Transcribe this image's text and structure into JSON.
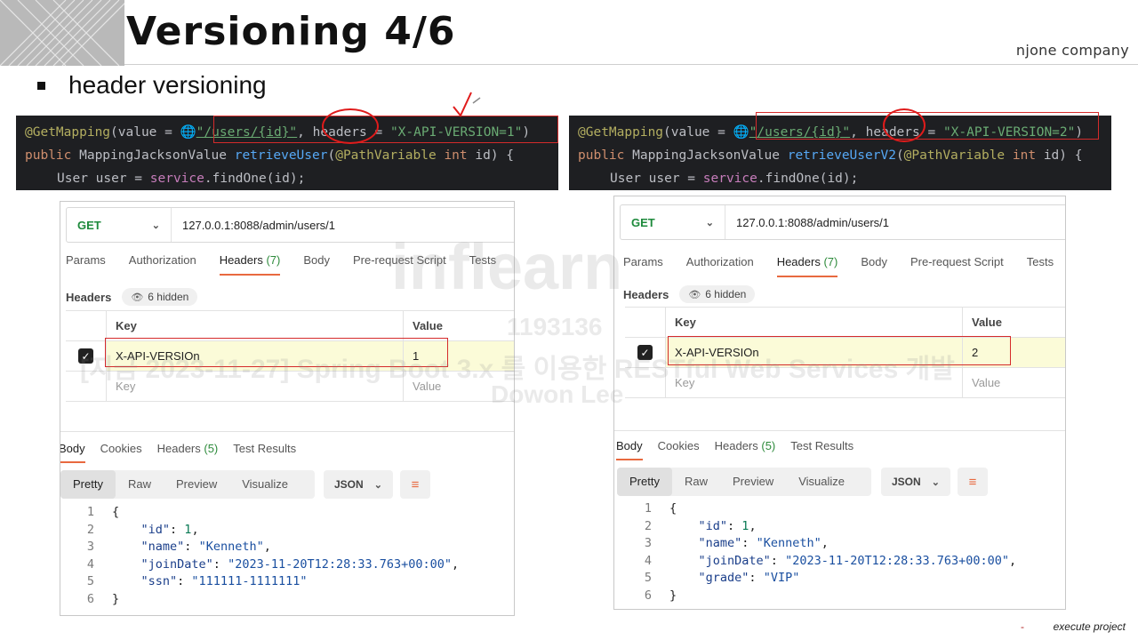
{
  "slide": {
    "title": "Versioning 4/6",
    "brand": "njone company",
    "bullet": "header versioning",
    "footer": "execute project",
    "footer_marker": "-"
  },
  "watermark": {
    "logo": "inflearn",
    "id": "1193136",
    "course": "[지금 2023-11-27] Spring Boot 3.x 를 이용한 RESTful Web Services 개발",
    "author": "Dowon Lee"
  },
  "code_left": {
    "l1_ann": "@GetMapping",
    "l1_a": "(value = ",
    "l1_globe": "🌐",
    "l1_url": "\"/users/{id}\"",
    "l1_b": ", ",
    "l1_headers": "headers",
    "l1_c": " = ",
    "l1_val": "\"X-API-VERSION=1\"",
    "l1_d": ")",
    "l2_kw": "public",
    "l2_type": " MappingJacksonValue ",
    "l2_fn": "retrieveUser",
    "l2_a": "(",
    "l2_ann": "@PathVariable",
    "l2_int": " int",
    "l2_b": " id) {",
    "l3_a": "User user = ",
    "l3_field": "service",
    "l3_b": ".findOne(id);"
  },
  "code_right": {
    "l1_ann": "@GetMapping",
    "l1_a": "(value = ",
    "l1_globe": "🌐",
    "l1_url": "\"/users/{id}\"",
    "l1_b": ", ",
    "l1_headers": "headers",
    "l1_c": " = ",
    "l1_val": "\"X-API-VERSION=2\"",
    "l1_d": ")",
    "l2_kw": "public",
    "l2_type": " MappingJacksonValue ",
    "l2_fn": "retrieveUserV2",
    "l2_a": "(",
    "l2_ann": "@PathVariable",
    "l2_int": " int",
    "l2_b": " id) {",
    "l3_a": "User user = ",
    "l3_field": "service",
    "l3_b": ".findOne(id);"
  },
  "postman_left": {
    "method": "GET",
    "url": "127.0.0.1:8088/admin/users/1",
    "tabs": {
      "params": "Params",
      "authorization": "Authorization",
      "headers": "Headers",
      "headers_count": "(7)",
      "body": "Body",
      "prerequest": "Pre-request Script",
      "tests": "Tests"
    },
    "headers_label": "Headers",
    "hidden": "6 hidden",
    "table": {
      "key_header": "Key",
      "value_header": "Value",
      "row_key": "X-API-VERSIOn",
      "row_value": "1",
      "key_placeholder": "Key",
      "value_placeholder": "Value"
    },
    "resp_tabs": {
      "body": "Body",
      "cookies": "Cookies",
      "headers": "Headers",
      "headers_count": "(5)",
      "tests": "Test Results"
    },
    "view": {
      "pretty": "Pretty",
      "raw": "Raw",
      "preview": "Preview",
      "visualize": "Visualize",
      "format": "JSON"
    },
    "json": {
      "n1": "1",
      "n2": "2",
      "n3": "3",
      "n4": "4",
      "n5": "5",
      "n6": "6",
      "open": "{",
      "k_id": "\"id\"",
      "v_id": "1",
      "k_name": "\"name\"",
      "v_name": "\"Kenneth\"",
      "k_join": "\"joinDate\"",
      "v_join": "\"2023-11-20T12:28:33.763+00:00\"",
      "k_last": "\"ssn\"",
      "v_last": "\"111111-1111111\"",
      "close": "}"
    }
  },
  "postman_right": {
    "method": "GET",
    "url": "127.0.0.1:8088/admin/users/1",
    "tabs": {
      "params": "Params",
      "authorization": "Authorization",
      "headers": "Headers",
      "headers_count": "(7)",
      "body": "Body",
      "prerequest": "Pre-request Script",
      "tests": "Tests"
    },
    "headers_label": "Headers",
    "hidden": "6 hidden",
    "table": {
      "key_header": "Key",
      "value_header": "Value",
      "row_key": "X-API-VERSIOn",
      "row_value": "2",
      "key_placeholder": "Key",
      "value_placeholder": "Value"
    },
    "resp_tabs": {
      "body": "Body",
      "cookies": "Cookies",
      "headers": "Headers",
      "headers_count": "(5)",
      "tests": "Test Results"
    },
    "view": {
      "pretty": "Pretty",
      "raw": "Raw",
      "preview": "Preview",
      "visualize": "Visualize",
      "format": "JSON"
    },
    "json": {
      "n1": "1",
      "n2": "2",
      "n3": "3",
      "n4": "4",
      "n5": "5",
      "n6": "6",
      "open": "{",
      "k_id": "\"id\"",
      "v_id": "1",
      "k_name": "\"name\"",
      "v_name": "\"Kenneth\"",
      "k_join": "\"joinDate\"",
      "v_join": "\"2023-11-20T12:28:33.763+00:00\"",
      "k_last": "\"grade\"",
      "v_last": "\"VIP\"",
      "close": "}"
    }
  },
  "colors": {
    "accent_orange": "#e8693f",
    "annotation_red": "#d52b2b",
    "method_green": "#1e8a3c"
  }
}
